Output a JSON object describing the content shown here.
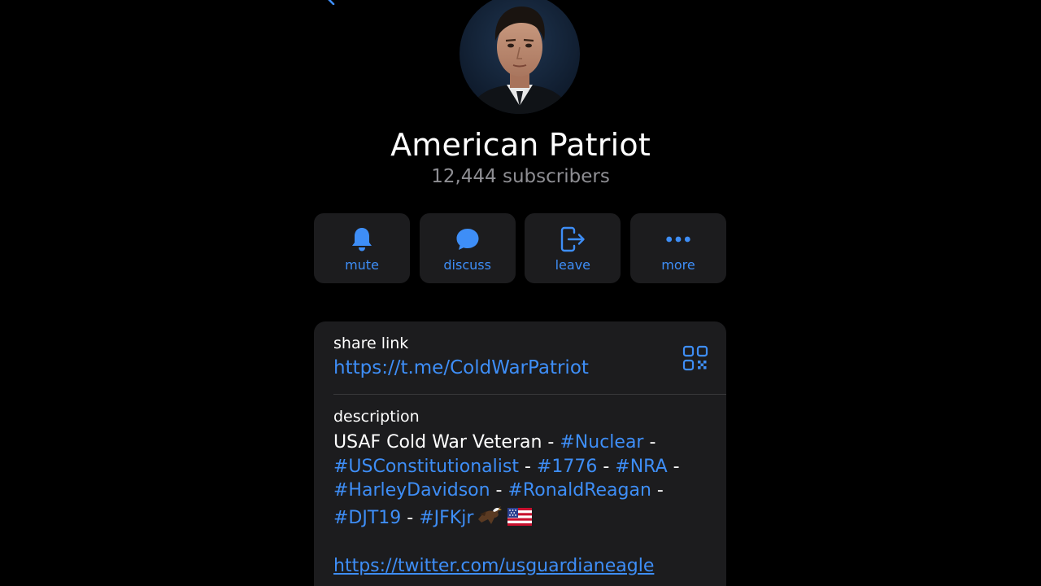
{
  "channel": {
    "title": "American Patriot",
    "subscribers": "12,444 subscribers"
  },
  "actions": [
    {
      "label": "mute",
      "icon": "bell-icon"
    },
    {
      "label": "discuss",
      "icon": "chat-bubble-icon"
    },
    {
      "label": "leave",
      "icon": "leave-icon"
    },
    {
      "label": "more",
      "icon": "ellipsis-icon"
    }
  ],
  "share_link": {
    "label": "share link",
    "url": "https://t.me/ColdWarPatriot",
    "icon": "qr-code-icon"
  },
  "description": {
    "label": "description",
    "text_intro": "USAF Cold War Veteran - ",
    "sep": " - ",
    "trail": " -",
    "tags": [
      "#Nuclear",
      "#USConstitutionalist",
      "#1776",
      "#NRA",
      "#HarleyDavidson",
      "#RonaldReagan",
      "#DJT19",
      "#JFKjr"
    ],
    "emojis": [
      "eagle-icon",
      "us-flag-icon"
    ],
    "link": "https://twitter.com/usguardianeagle"
  },
  "colors": {
    "background": "#000000",
    "card": "#1c1c1e",
    "accent": "#3e8ef7",
    "secondary_text": "#8e8e93"
  }
}
